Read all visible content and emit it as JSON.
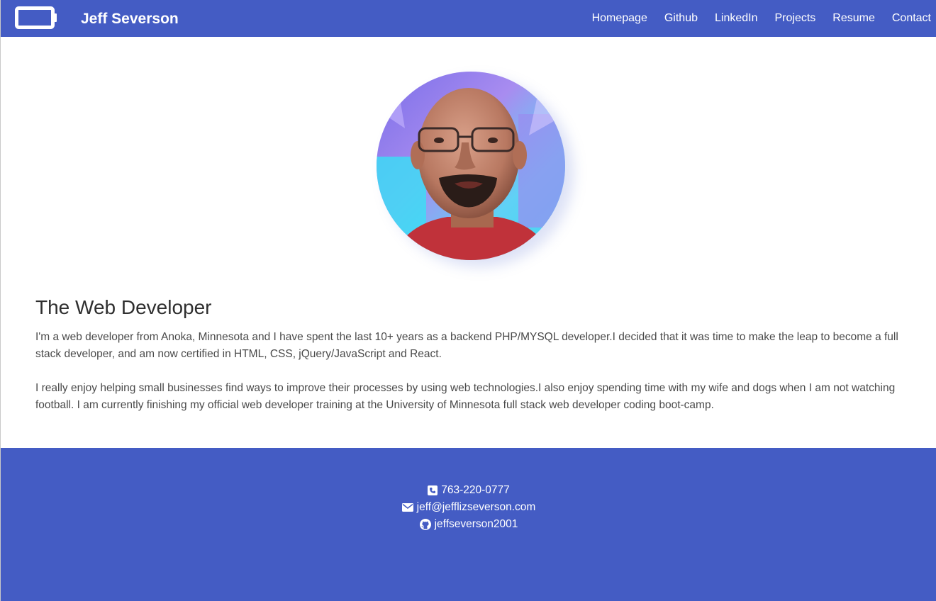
{
  "navbar": {
    "brand_icon": "battery-icon",
    "brand_name": "Jeff Severson",
    "links": [
      {
        "label": "Homepage"
      },
      {
        "label": "Github"
      },
      {
        "label": "LinkedIn"
      },
      {
        "label": "Projects"
      },
      {
        "label": "Resume"
      },
      {
        "label": "Contact"
      }
    ]
  },
  "profile": {
    "avatar_alt": "profile-photo"
  },
  "about": {
    "title": "The Web Developer",
    "paragraphs": [
      "I'm a web developer from Anoka, Minnesota and I have spent the last 10+ years as a backend PHP/MYSQL developer.I decided that it was time to make the leap to become a full stack developer, and am now certified in HTML, CSS, jQuery/JavaScript and React.",
      "I really enjoy helping small businesses find ways to improve their processes by using web technologies.I also enjoy spending time with my wife and dogs when I am not watching football. I am currently finishing my official web developer training at the University of Minnesota full stack web developer coding boot-camp."
    ]
  },
  "footer": {
    "contacts": [
      {
        "icon": "phone-icon",
        "text": "763-220-0777"
      },
      {
        "icon": "envelope-icon",
        "text": "jeff@jefflizseverson.com"
      },
      {
        "icon": "github-icon",
        "text": "jeffseverson2001"
      }
    ]
  },
  "colors": {
    "primary": "#445cc4",
    "text_dark": "#2f2f2f",
    "text_body": "#4a4a4a",
    "white": "#ffffff"
  }
}
